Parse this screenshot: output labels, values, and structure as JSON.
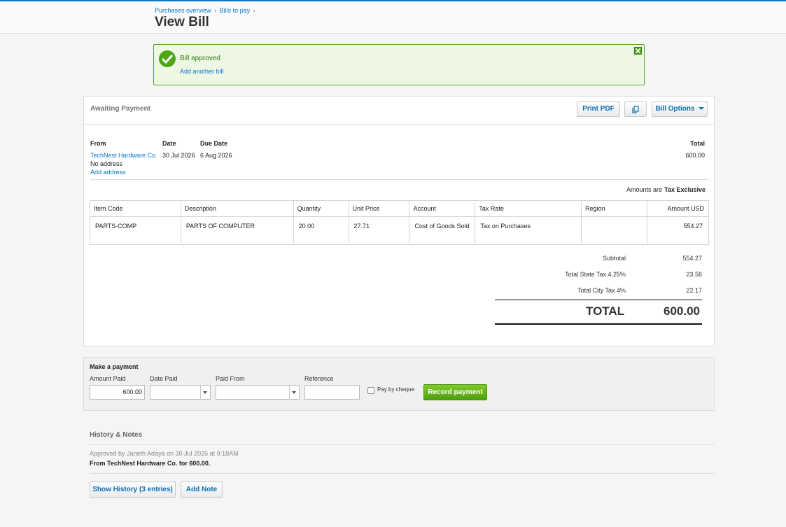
{
  "header": {
    "breadcrumbs": [
      "Purchases overview",
      "Bills to pay"
    ],
    "breadcrumb_sep": "›",
    "title": "View Bill"
  },
  "alert": {
    "message": "Bill approved",
    "link": "Add another bill"
  },
  "bill": {
    "status": "Awaiting Payment",
    "buttons": {
      "print": "Print PDF",
      "options": "Bill Options"
    },
    "labels": {
      "from": "From",
      "date": "Date",
      "due_date": "Due Date",
      "total": "Total"
    },
    "from": "TechNest Hardware Co.",
    "address": "No address",
    "add_address": "Add address",
    "date": "30 Jul 2026",
    "due_date": "6 Aug 2026",
    "total": "600.00",
    "amounts_are_label": "Amounts are",
    "amounts_are_value": "Tax Exclusive",
    "columns": [
      "Item Code",
      "Description",
      "Quantity",
      "Unit Price",
      "Account",
      "Tax Rate",
      "Region",
      "Amount USD"
    ],
    "rows": [
      {
        "item_code": "PARTS-COMP",
        "description": "PARTS OF COMPUTER",
        "quantity": "20.00",
        "unit_price": "27.71",
        "account": "Cost of Goods Sold",
        "tax_rate": "Tax on Purchases",
        "region": "",
        "amount": "554.27"
      }
    ],
    "summary": {
      "subtotal_label": "Subtotal",
      "subtotal": "554.27",
      "state_tax_label": "Total State Tax 4.25%",
      "state_tax": "23.56",
      "city_tax_label": "Total City Tax 4%",
      "city_tax": "22.17",
      "total_label": "TOTAL",
      "total": "600.00"
    }
  },
  "payment": {
    "title": "Make a payment",
    "amount_label": "Amount Paid",
    "amount_value": "600.00",
    "date_label": "Date Paid",
    "date_value": "",
    "from_label": "Paid From",
    "from_value": "",
    "reference_label": "Reference",
    "reference_value": "",
    "cheque_label": "Pay by cheque",
    "cheque_checked": false,
    "record_button": "Record payment"
  },
  "history": {
    "title": "History & Notes",
    "entry": "Approved by Janeth Adaya on 30 Jul 2026 at 9:18AM",
    "detail": "From TechNest Hardware Co. for 600.00.",
    "show_history_button": "Show History (3 entries)",
    "add_note_button": "Add Note"
  },
  "colors": {
    "accent": "#0b78c9",
    "success": "#50a517",
    "alert_bg": "#eef7e4"
  }
}
